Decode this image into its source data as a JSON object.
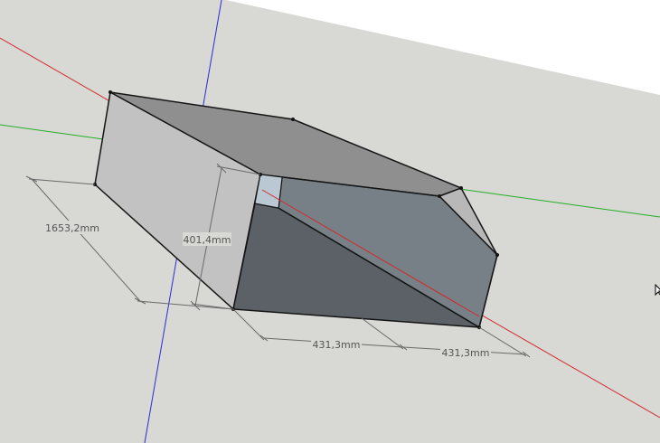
{
  "model": {
    "colors": {
      "background_sky": "#ffffff",
      "background_ground": "#d8d8d5",
      "axis_red": "#d42a2a",
      "axis_green": "#22b022",
      "axis_blue": "#2a2ad4",
      "face_top": "#8f8f8f",
      "face_left": "#c2c2c2",
      "face_right_end": "#b8b8b8",
      "face_inner_wall": "#768086",
      "face_inner_floor": "#5b6166",
      "face_opening_highlight": "#b9c8d2",
      "edge": "#141414",
      "dimension_line": "#6a6a6a",
      "dimension_text": "#555555"
    },
    "dimensions": {
      "depth": "1653,2mm",
      "height": "401,4mm",
      "width_a": "431,3mm",
      "width_b": "431,3mm"
    }
  }
}
